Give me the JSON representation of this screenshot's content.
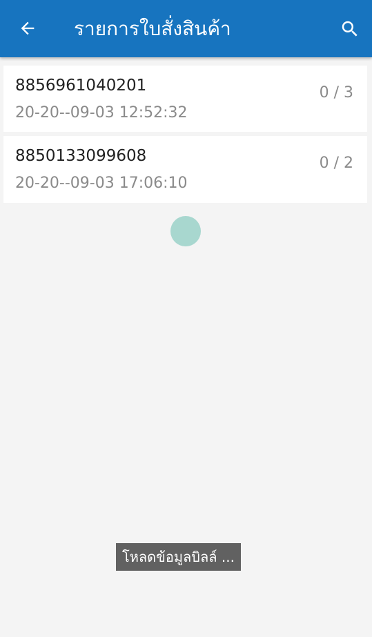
{
  "app_bar": {
    "title": "รายการใบสั่งสินค้า",
    "background_color": "#1774bf",
    "back_icon": "arrow-left-icon",
    "search_icon": "search-icon"
  },
  "orders": [
    {
      "code": "8856961040201",
      "datetime": "20-20--09-03 12:52:32",
      "count": "0 / 3"
    },
    {
      "code": "8850133099608",
      "datetime": "20-20--09-03 17:06:10",
      "count": "0 / 2"
    }
  ],
  "loading": {
    "spinner_color": "#a8d7cf",
    "toast_text": "โหลดข้อมูลบิลล์ ..."
  }
}
